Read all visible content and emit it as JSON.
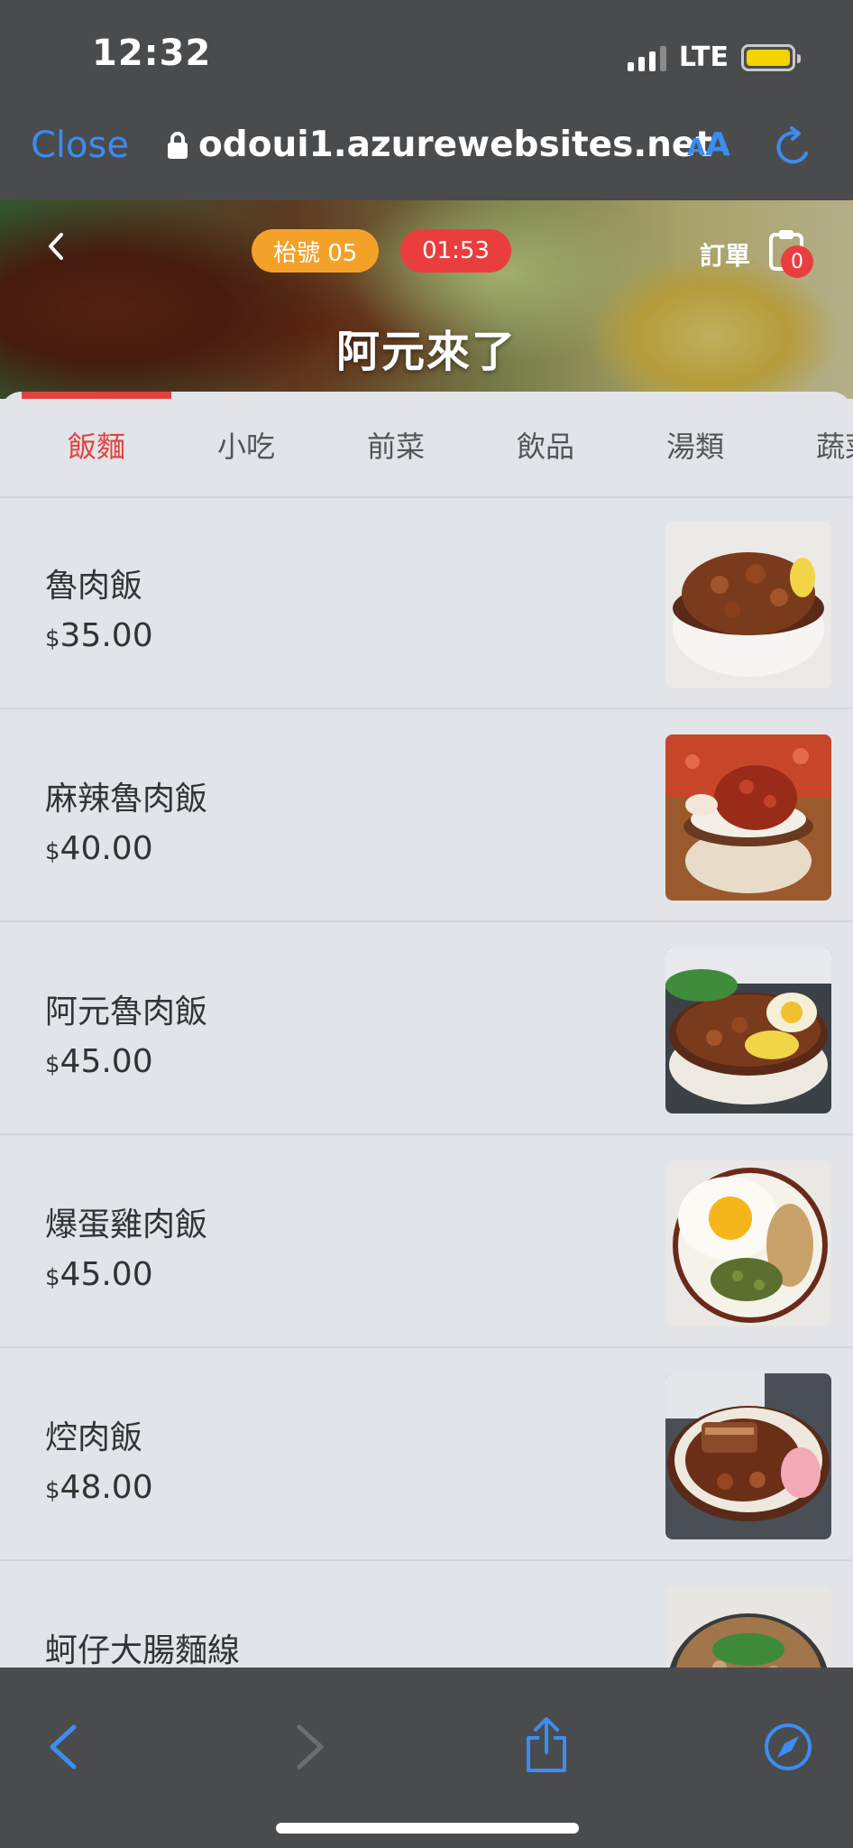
{
  "status_bar": {
    "time": "12:32",
    "network": "LTE",
    "battery_color": "#f2d400"
  },
  "browser": {
    "close_label": "Close",
    "url": "odoui1.azurewebsites.net",
    "aa_small": "A",
    "aa_large": "A",
    "accent_color": "#3d8cf0"
  },
  "header": {
    "table_badge": "枱號 05",
    "timer": "01:53",
    "order_label": "訂單",
    "cart_count": "0",
    "store_name": "阿元來了"
  },
  "tabs": [
    {
      "label": "飯麵",
      "active": true
    },
    {
      "label": "小吃",
      "active": false
    },
    {
      "label": "前菜",
      "active": false
    },
    {
      "label": "飲品",
      "active": false
    },
    {
      "label": "湯類",
      "active": false
    },
    {
      "label": "蔬菜",
      "active": false
    }
  ],
  "menu_items": [
    {
      "name": "魯肉飯",
      "currency": "$",
      "price": "35.00"
    },
    {
      "name": "麻辣魯肉飯",
      "currency": "$",
      "price": "40.00"
    },
    {
      "name": "阿元魯肉飯",
      "currency": "$",
      "price": "45.00"
    },
    {
      "name": "爆蛋雞肉飯",
      "currency": "$",
      "price": "45.00"
    },
    {
      "name": "焢肉飯",
      "currency": "$",
      "price": "48.00"
    },
    {
      "name": "蚵仔大腸麵線",
      "currency": "$",
      "price": ""
    }
  ],
  "colors": {
    "accent_red": "#e2423e",
    "badge_orange": "#f4a12a",
    "timer_red": "#ea3e3e"
  }
}
